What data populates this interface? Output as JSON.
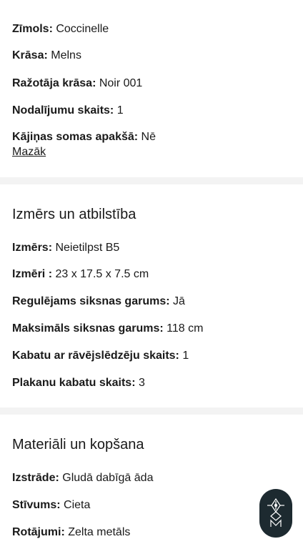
{
  "section1": {
    "rows": [
      {
        "k": "Zīmols:",
        "v": " Coccinelle"
      },
      {
        "k": "Krāsa:",
        "v": " Melns"
      },
      {
        "k": "Ražotāja krāsa:",
        "v": " Noir 001"
      },
      {
        "k": "Nodalījumu skaits:",
        "v": " 1"
      },
      {
        "k": "Kājiņas somas apakšā:",
        "v": " Nē"
      }
    ],
    "less_link": "Mazāk"
  },
  "section2": {
    "title": "Izmērs un atbilstība",
    "rows": [
      {
        "k": "Izmērs:",
        "v": " Neietilpst B5"
      },
      {
        "k": "Izmēri :",
        "v": " 23 x 17.5 x 7.5 cm"
      },
      {
        "k": "Regulējams siksnas garums:",
        "v": " Jā"
      },
      {
        "k": "Maksimāls siksnas garums:",
        "v": " 118 cm"
      },
      {
        "k": "Kabatu ar rāvējslēdzēju skaits:",
        "v": " 1"
      },
      {
        "k": "Plakanu kabatu skaits:",
        "v": " 3"
      }
    ]
  },
  "section3": {
    "title": "Materiāli un kopšana",
    "rows": [
      {
        "k": "Izstrāde:",
        "v": " Gludā dabīgā āda"
      },
      {
        "k": "Stīvums:",
        "v": " Cieta"
      },
      {
        "k": "Rotājumi:",
        "v": " Zelta metāls"
      }
    ]
  },
  "assistant_button": {
    "icon": "assistant-logo-icon"
  },
  "colors": {
    "separator": "#f3f3f3",
    "text": "#1a1a1a",
    "fab": "#1d2a30"
  }
}
